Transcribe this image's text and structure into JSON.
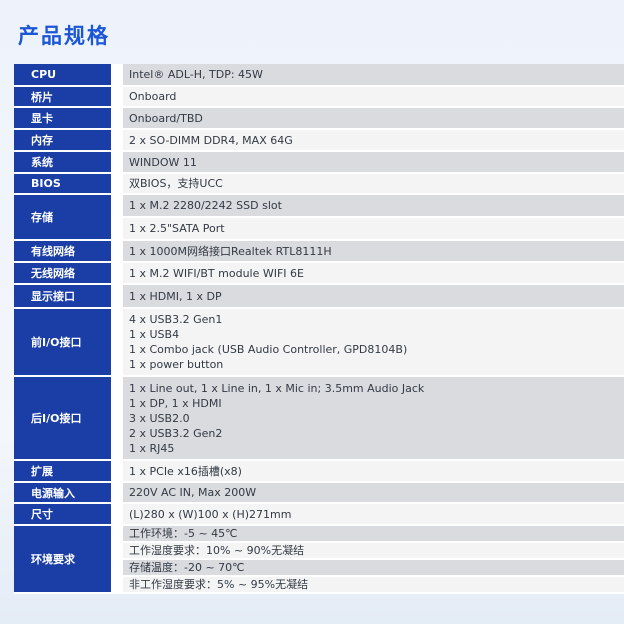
{
  "title": "产品规格",
  "rows": [
    {
      "label": "CPU",
      "values": [
        "Intel® ADL-H, TDP: 45W"
      ]
    },
    {
      "label": "桥片",
      "values": [
        "Onboard"
      ]
    },
    {
      "label": "显卡",
      "values": [
        "Onboard/TBD"
      ]
    },
    {
      "label": "内存",
      "values": [
        "2 x SO-DIMM DDR4, MAX 64G"
      ]
    },
    {
      "label": "系统",
      "values": [
        "WINDOW 11"
      ]
    },
    {
      "label": "BIOS",
      "values": [
        "双BIOS，支持UCC"
      ]
    },
    {
      "label": "存储",
      "values": [
        "1 x M.2 2280/2242 SSD slot",
        "1 x 2.5\"SATA Port"
      ]
    },
    {
      "label": "有线网络",
      "values": [
        "1 x 1000M网络接口Realtek RTL8111H"
      ]
    },
    {
      "label": "无线网络",
      "values": [
        "1 x M.2 WIFI/BT module WIFI 6E"
      ]
    },
    {
      "label": "显示接口",
      "values": [
        "1 x HDMI, 1 x DP"
      ]
    },
    {
      "label": "前I/O接口",
      "values": [
        "4 x USB3.2 Gen1",
        "1 x USB4",
        "1 x Combo jack (USB Audio Controller, GPD8104B)",
        "1 x power button"
      ]
    },
    {
      "label": "后I/O接口",
      "values": [
        "1 x Line out, 1 x Line in, 1 x Mic in; 3.5mm Audio Jack",
        "1 x DP, 1 x HDMI",
        "3 x USB2.0",
        "2 x USB3.2 Gen2",
        "1 x RJ45"
      ]
    },
    {
      "label": "扩展",
      "values": [
        "1 x PCIe x16插槽(x8)"
      ]
    },
    {
      "label": "电源输入",
      "values": [
        "220V AC IN, Max 200W"
      ]
    },
    {
      "label": "尺寸",
      "values": [
        "(L)280 x (W)100 x (H)271mm"
      ]
    },
    {
      "label": "环境要求",
      "values": [
        "工作环境：-5 ~ 45℃",
        "工作湿度要求：10% ~ 90%无凝结",
        "存储温度：-20 ~ 70℃",
        "非工作湿度要求：5% ~ 95%无凝结"
      ]
    }
  ]
}
